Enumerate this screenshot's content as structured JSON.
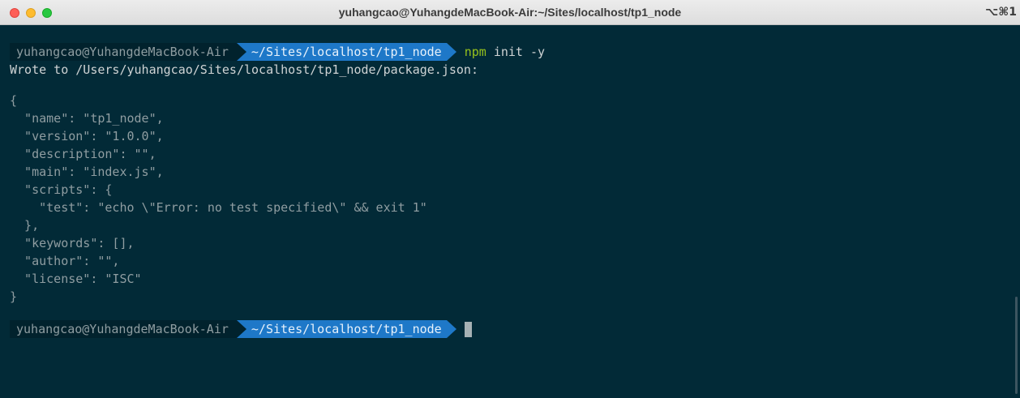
{
  "window": {
    "title": "yuhangcao@YuhangdeMacBook-Air:~/Sites/localhost/tp1_node",
    "shortcut": "⌥⌘1"
  },
  "prompt1": {
    "user": "yuhangcao@YuhangdeMacBook-Air",
    "dir": "~/Sites/localhost/tp1_node",
    "command": "npm",
    "args": " init -y"
  },
  "output": {
    "wrote": "Wrote to /Users/yuhangcao/Sites/localhost/tp1_node/package.json:",
    "json_lines": [
      "{",
      "  \"name\": \"tp1_node\",",
      "  \"version\": \"1.0.0\",",
      "  \"description\": \"\",",
      "  \"main\": \"index.js\",",
      "  \"scripts\": {",
      "    \"test\": \"echo \\\"Error: no test specified\\\" && exit 1\"",
      "  },",
      "  \"keywords\": [],",
      "  \"author\": \"\",",
      "  \"license\": \"ISC\"",
      "}"
    ]
  },
  "prompt2": {
    "user": "yuhangcao@YuhangdeMacBook-Air",
    "dir": "~/Sites/localhost/tp1_node"
  },
  "colors": {
    "background": "#022a37",
    "prompt_dir": "#1e78c8",
    "npm": "#97c21c"
  }
}
